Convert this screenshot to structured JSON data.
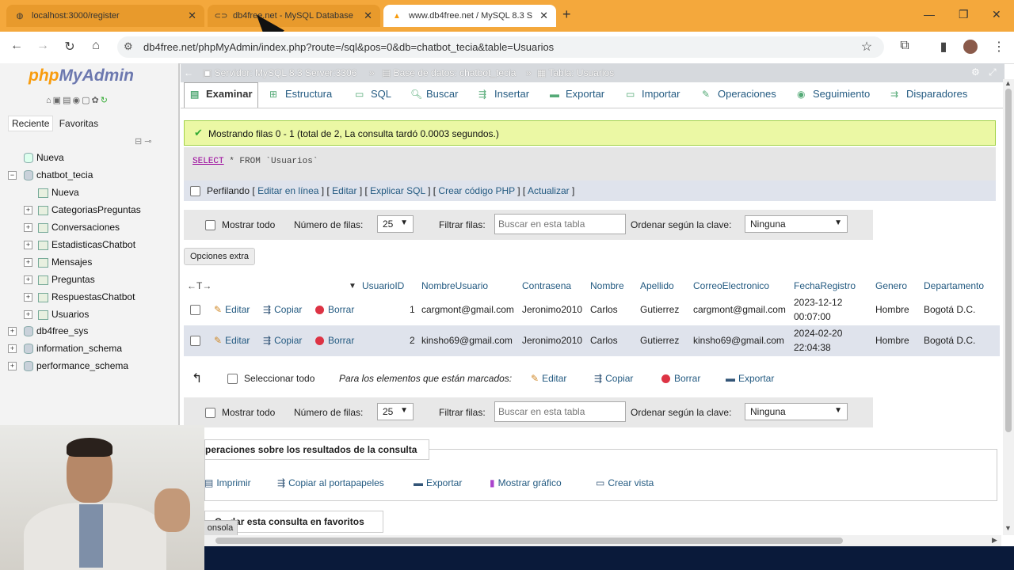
{
  "browser": {
    "tabs": [
      {
        "title": "localhost:3000/register",
        "active": false
      },
      {
        "title": "db4free.net - MySQL Database",
        "active": false
      },
      {
        "title": "www.db4free.net / MySQL 8.3 S",
        "active": true
      }
    ],
    "url": "db4free.net/phpMyAdmin/index.php?route=/sql&pos=0&db=chatbot_tecia&table=Usuarios"
  },
  "sidebar": {
    "logo_php": "php",
    "logo_myadmin": "MyAdmin",
    "tabs": [
      "Reciente",
      "Favoritas"
    ],
    "tree": {
      "new_top": "Nueva",
      "db_chatbot": "chatbot_tecia",
      "new_in_db": "Nueva",
      "tables": [
        "CategoriasPreguntas",
        "Conversaciones",
        "EstadisticasChatbot",
        "Mensajes",
        "Preguntas",
        "RespuestasChatbot",
        "Usuarios"
      ],
      "other_dbs": [
        "db4free_sys",
        "information_schema",
        "performance_schema"
      ]
    }
  },
  "breadcrumb": {
    "server": "Servidor: MySQL 8.3 Server:3306",
    "database": "Base de datos: chatbot_tecia",
    "table": "Tabla: Usuarios"
  },
  "navtabs": [
    "Examinar",
    "Estructura",
    "SQL",
    "Buscar",
    "Insertar",
    "Exportar",
    "Importar",
    "Operaciones",
    "Seguimiento",
    "Disparadores"
  ],
  "result": {
    "message": "Mostrando filas 0 - 1 (total de 2, La consulta tardó 0.0003 segundos.)",
    "sql_kw": "SELECT",
    "sql_rest": " * FROM `Usuarios`",
    "profile_label": "Perfilando",
    "profile_links": [
      "Editar en línea",
      "Editar",
      "Explicar SQL",
      "Crear código PHP",
      "Actualizar"
    ]
  },
  "controls": {
    "show_all": "Mostrar todo",
    "rows_label": "Número de filas:",
    "rows_value": "25",
    "filter_label": "Filtrar filas:",
    "filter_placeholder": "Buscar en esta tabla",
    "sort_label": "Ordenar según la clave:",
    "sort_value": "Ninguna",
    "extra_options": "Opciones extra"
  },
  "table": {
    "columns": [
      "UsuarioID",
      "NombreUsuario",
      "Contrasena",
      "Nombre",
      "Apellido",
      "CorreoElectronico",
      "FechaRegistro",
      "Genero",
      "Departamento"
    ],
    "actions": {
      "edit": "Editar",
      "copy": "Copiar",
      "delete": "Borrar"
    },
    "rows": [
      {
        "id": "1",
        "username": "cargmont@gmail.com",
        "password": "Jeronimo2010",
        "name": "Carlos",
        "surname": "Gutierrez",
        "email": "cargmont@gmail.com",
        "date1": "2023-12-12",
        "date2": "00:07:00",
        "gender": "Hombre",
        "dept": "Bogotá D.C."
      },
      {
        "id": "2",
        "username": "kinsho69@gmail.com",
        "password": "Jeronimo2010",
        "name": "Carlos",
        "surname": "Gutierrez",
        "email": "kinsho69@gmail.com",
        "date1": "2024-02-20",
        "date2": "22:04:38",
        "gender": "Hombre",
        "dept": "Bogotá D.C."
      }
    ]
  },
  "bulk": {
    "select_all": "Seleccionar todo",
    "marked_label": "Para los elementos que están marcados:",
    "edit": "Editar",
    "copy": "Copiar",
    "delete": "Borrar",
    "export": "Exportar"
  },
  "query_ops": {
    "title": "peraciones sobre los resultados de la consulta",
    "items": [
      "Imprimir",
      "Copiar al portapapeles",
      "Exportar",
      "Mostrar gráfico",
      "Crear vista"
    ],
    "fav_title_a": "C",
    "fav_title_b": "dar esta consulta en favoritos",
    "console": "onsola"
  }
}
